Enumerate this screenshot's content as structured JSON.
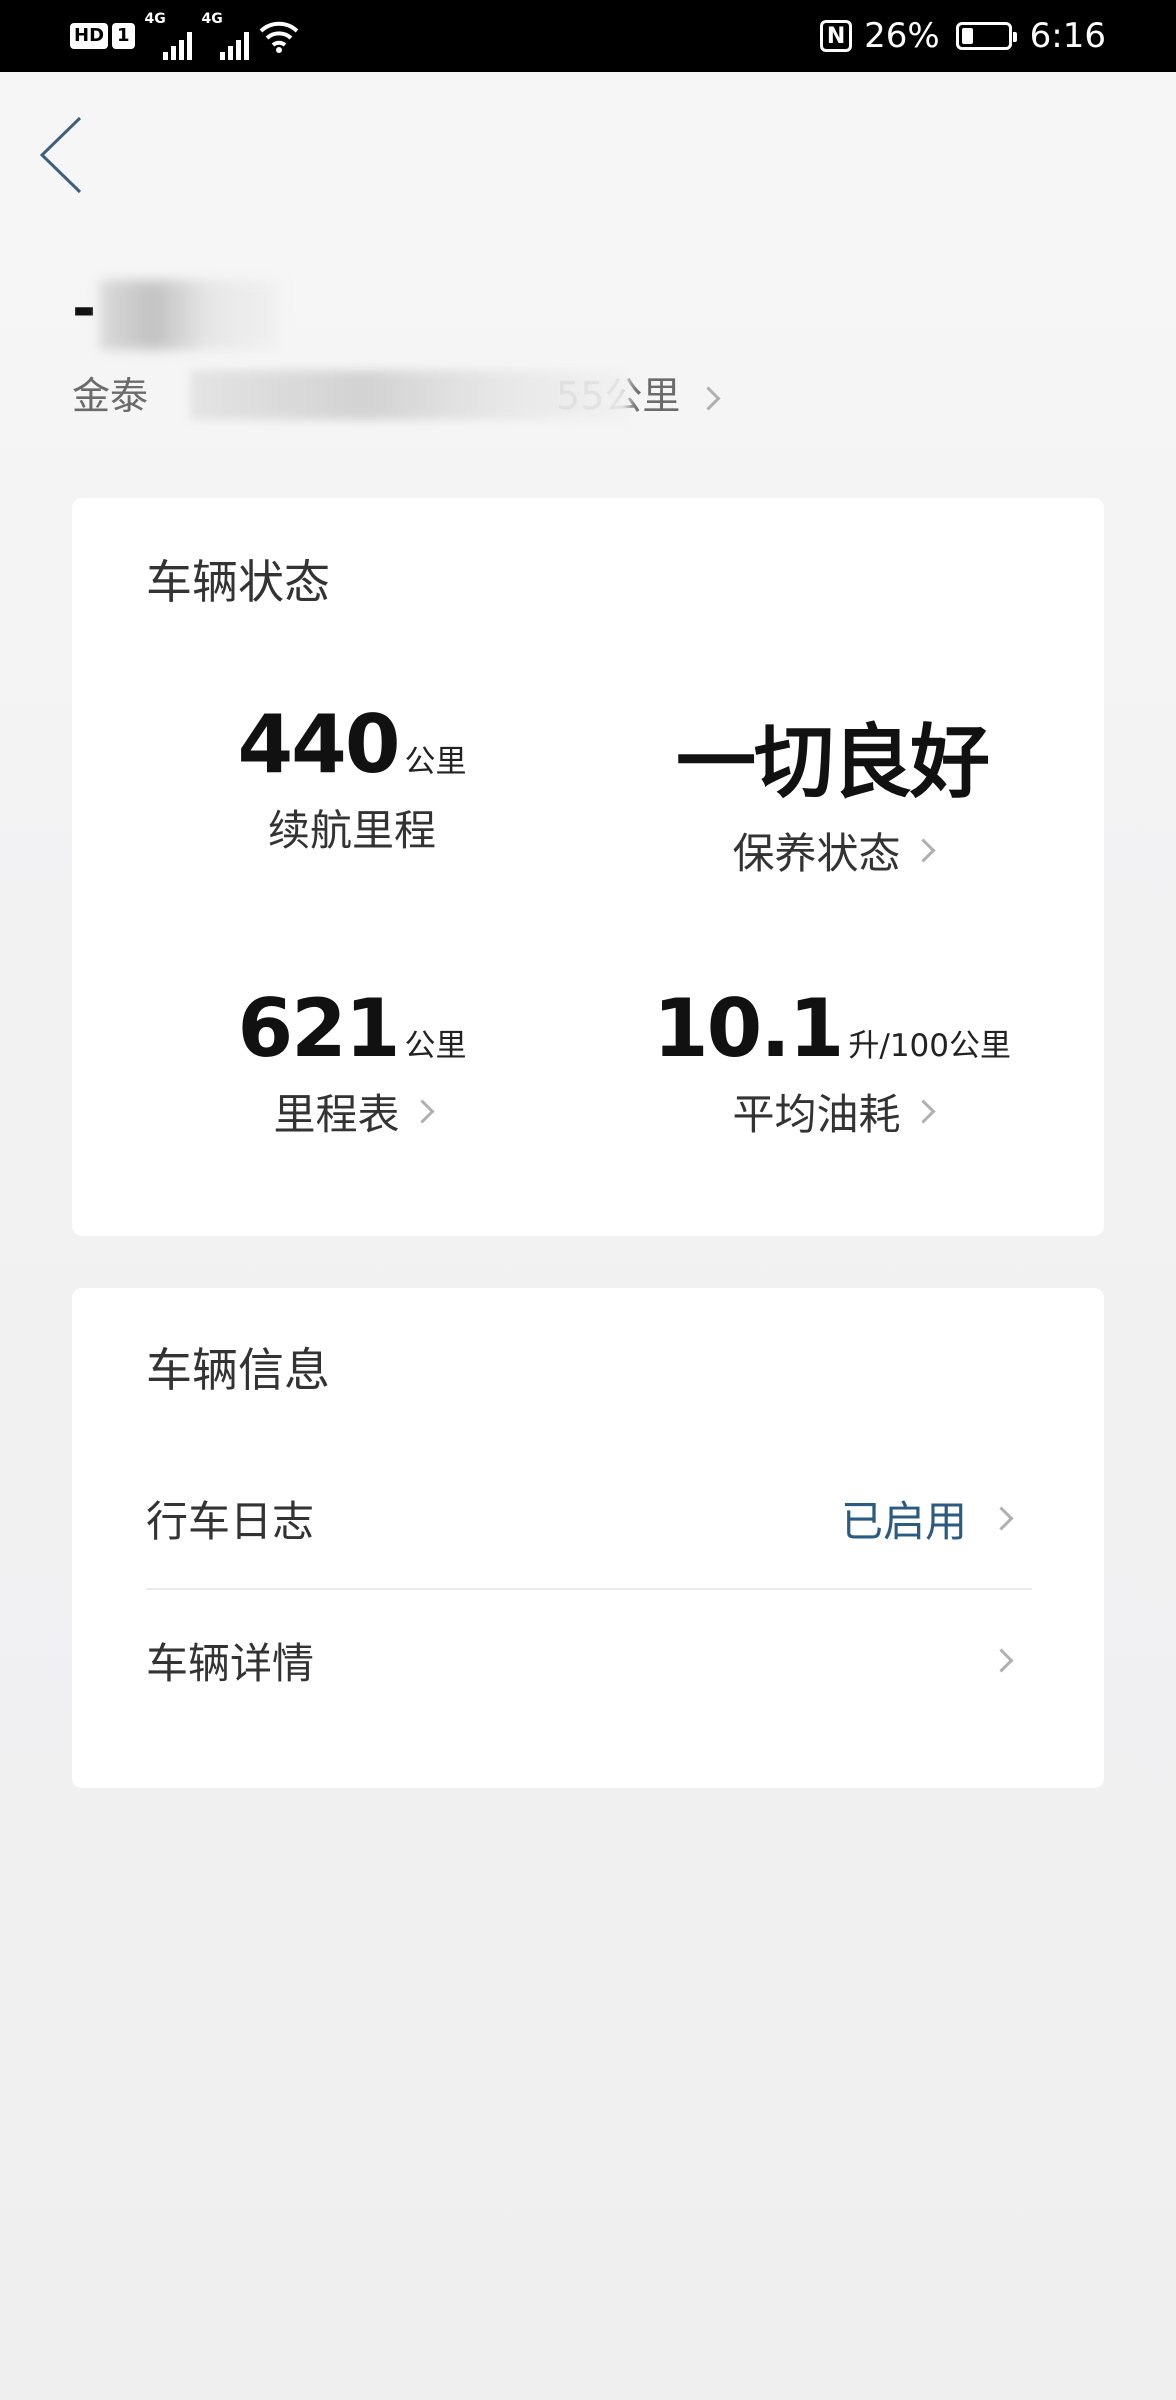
{
  "status_bar": {
    "hd_label": "HD",
    "sim_label": "1",
    "network_1": "4G",
    "network_2": "4G",
    "battery_percent": "26%",
    "battery_level": 0.26,
    "time": "6:16",
    "icons": [
      "nfc-icon",
      "battery-icon",
      "wifi-icon",
      "signal-icon"
    ]
  },
  "header": {
    "car_name": "-",
    "dealer_line_prefix": "金泰",
    "dealer_line_suffix": "55公里"
  },
  "vehicle_status": {
    "title": "车辆状态",
    "range": {
      "value": "440",
      "unit": "公里",
      "label": "续航里程"
    },
    "maintenance": {
      "value": "一切良好",
      "label": "保养状态"
    },
    "odometer": {
      "value": "621",
      "unit": "公里",
      "label": "里程表"
    },
    "fuel": {
      "value": "10.1",
      "unit": "升/100公里",
      "label": "平均油耗"
    }
  },
  "vehicle_info": {
    "title": "车辆信息",
    "trip_log": {
      "label": "行车日志",
      "value": "已启用"
    },
    "details": {
      "label": "车辆详情"
    }
  },
  "colors": {
    "accent_text": "#2b5b80",
    "back_arrow": "#3f5f7f",
    "status_bar_bg": "#000000"
  }
}
